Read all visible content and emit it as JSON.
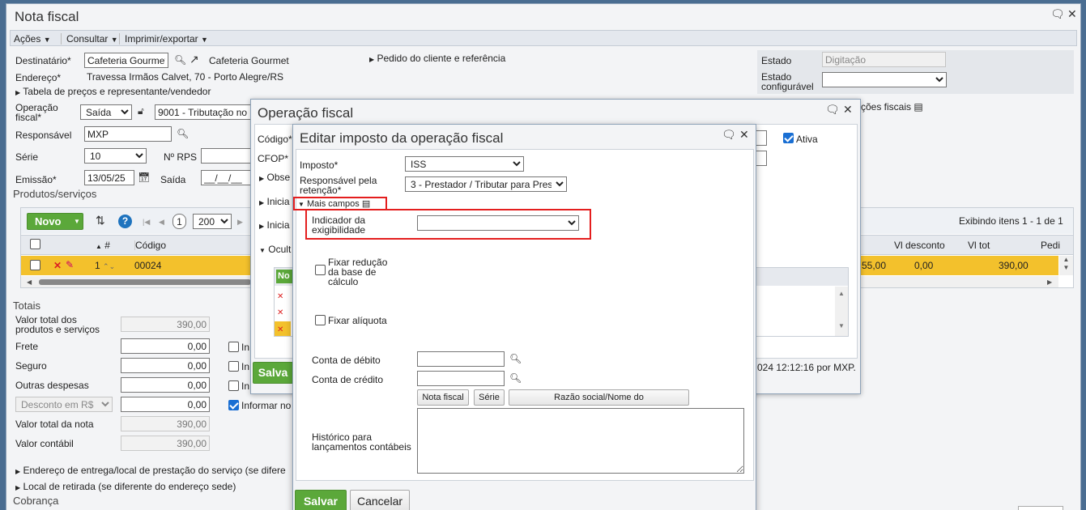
{
  "window": {
    "title": "Nota fiscal"
  },
  "menu": [
    {
      "label": "Ações"
    },
    {
      "label": "Consultar"
    },
    {
      "label": "Imprimir/exportar"
    }
  ],
  "header": {
    "destinatario_label": "Destinatário*",
    "destinatario_value": "Cafeteria Gourmet",
    "destinatario_text": "Cafeteria Gourmet",
    "pedido_link": "Pedido do cliente e referência",
    "endereco_label": "Endereço*",
    "endereco_value": "Travessa Irmãos Calvet, 70 - Porto Alegre/RS",
    "tabela_link": "Tabela de preços e representante/vendedor",
    "operacao_label": "Operação fiscal*",
    "operacao_tipo": "Saída",
    "operacao_value": "9001 - Tributação no",
    "responsavel_label": "Responsável",
    "responsavel_value": "MXP",
    "serie_label": "Série",
    "serie_value": "10",
    "nrps_label": "Nº RPS",
    "emissao_label": "Emissão*",
    "emissao_value": "13/05/25",
    "saida_label": "Saída",
    "saida_value": "__/__/__"
  },
  "status": {
    "estado_label": "Estado",
    "estado_value": "Digitação",
    "estado_config_label": "Estado configurável",
    "acoes_fiscais": "ções fiscais"
  },
  "produtos": {
    "title": "Produtos/serviços",
    "novo_label": "Novo",
    "page_value": "1",
    "per_page": "200",
    "exibindo": "Exibindo itens 1 - 1 de 1",
    "columns": {
      "num": "#",
      "codigo": "Código",
      "vl_desconto": "Vl desconto",
      "vl_tot": "Vl tot",
      "pedido": "Pedi"
    },
    "row": {
      "num": "1",
      "codigo": "00024",
      "partial": "55,00",
      "vl_desconto": "0,00",
      "vl_tot": "390,00"
    }
  },
  "totais": {
    "title": "Totais",
    "rows": [
      {
        "label": "Valor total dos produtos e serviços",
        "value": "390,00"
      },
      {
        "label": "Frete",
        "value": "0,00"
      },
      {
        "label": "Seguro",
        "value": "0,00"
      },
      {
        "label": "Outras despesas",
        "value": "0,00"
      },
      {
        "label": "Desconto em R$",
        "value": "0,00"
      },
      {
        "label": "Valor total da nota",
        "value": "390,00"
      },
      {
        "label": "Valor contábil",
        "value": "390,00"
      }
    ],
    "inf_short": "In",
    "informar": "Informar no"
  },
  "links": {
    "entrega": "Endereço de entrega/local de prestação do serviço (se difere",
    "retirada": "Local de retirada (se diferente do endereço sede)",
    "cobranca": "Cobrança"
  },
  "opfiscal": {
    "title": "Operação fiscal",
    "codigo_label": "Código*",
    "cfop_label": "CFOP*",
    "ativa_label": "Ativa",
    "obse": "Obse",
    "inicia1": "Inicia",
    "inicia2": "Inicia",
    "ocult": "Ocult",
    "no": "No",
    "salvar": "Salva",
    "audit": "024 12:12:16 por MXP."
  },
  "dialog": {
    "title": "Editar imposto da operação fiscal",
    "imposto_label": "Imposto*",
    "imposto_value": "ISS",
    "resp_label": "Responsável pela retenção*",
    "resp_value": "3 - Prestador / Tributar para Pres",
    "mais_campos": "Mais campos",
    "indicador_label": "Indicador da exigibilidade",
    "fixar_reducao": "Fixar redução da base de cálculo",
    "fixar_aliquota": "Fixar alíquota",
    "conta_debito": "Conta de débito",
    "conta_credito": "Conta de crédito",
    "btn_nota": "Nota fiscal",
    "btn_serie": "Série",
    "btn_razao": "Razão social/Nome do remetente/destinatário",
    "historico": "Histórico para lançamentos contábeis",
    "salvar": "Salvar",
    "cancelar": "Cancelar"
  },
  "colors": {
    "highlight": "#e41e1e",
    "green": "#5ba83a",
    "selected_row": "#f3c12c"
  }
}
